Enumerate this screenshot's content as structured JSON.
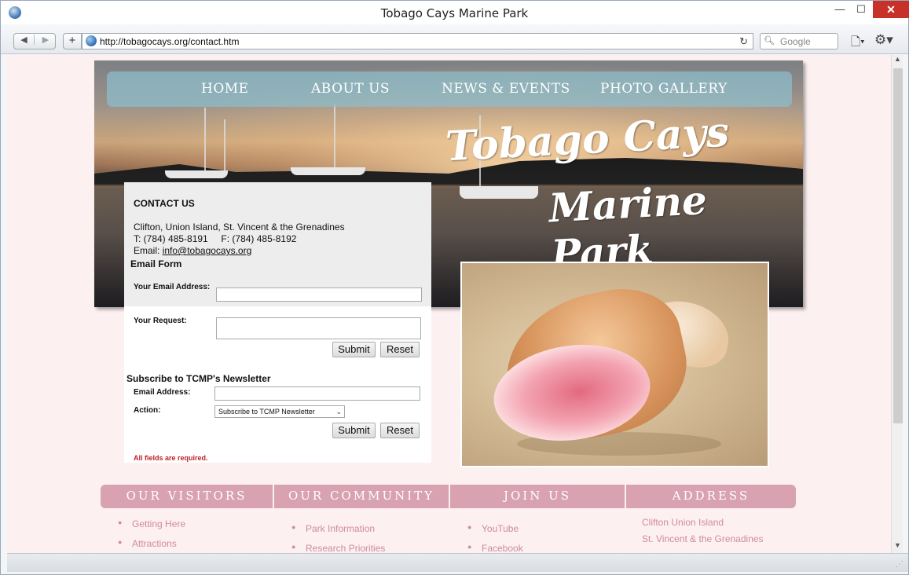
{
  "browser": {
    "title": "Tobago Cays Marine Park",
    "url": "http://tobagocays.org/contact.htm",
    "search_placeholder": "Google",
    "window_controls": {
      "minimize": "—",
      "maximize": "☐",
      "close": "✕"
    }
  },
  "site": {
    "nav": [
      "HOME",
      "ABOUT US",
      "NEWS & EVENTS",
      "PHOTO GALLERY"
    ],
    "logo": {
      "line1": "Tobago Cays",
      "line2": "Marine Park"
    }
  },
  "contact": {
    "heading": "CONTACT US",
    "address": "Clifton, Union Island, St. Vincent & the Grenadines",
    "phone_fax": "T: (784) 485-8191     F: (784) 485-8192",
    "email_label": "Email: ",
    "email": "info@tobagocays.org"
  },
  "email_form": {
    "title": "Email Form",
    "email_label": "Your Email Address:",
    "email_value": "",
    "request_label": "Your Request:",
    "request_value": "",
    "submit": "Submit",
    "reset": "Reset"
  },
  "newsletter": {
    "title": "Subscribe to TCMP's Newsletter",
    "email_label": "Email Address:",
    "email_value": "",
    "action_label": "Action:",
    "action_selected": "Subscribe to TCMP Newsletter",
    "submit": "Submit",
    "reset": "Reset",
    "required_note": "All fields are required."
  },
  "footer": {
    "tabs": [
      "OUR VISITORS",
      "OUR COMMUNITY",
      "JOIN US",
      "ADDRESS"
    ],
    "visitors": [
      "Getting Here",
      "Attractions"
    ],
    "community": [
      "Park Information",
      "Research Priorities"
    ],
    "join": [
      "YouTube",
      "Facebook"
    ],
    "address": [
      "Clifton Union Island",
      "St. Vincent & the Grenadines"
    ]
  },
  "colors": {
    "page_bg": "#fdf0f0",
    "footer_tab": "#d8a2b2",
    "footer_link": "#d08aa0",
    "required": "#c0202a"
  }
}
